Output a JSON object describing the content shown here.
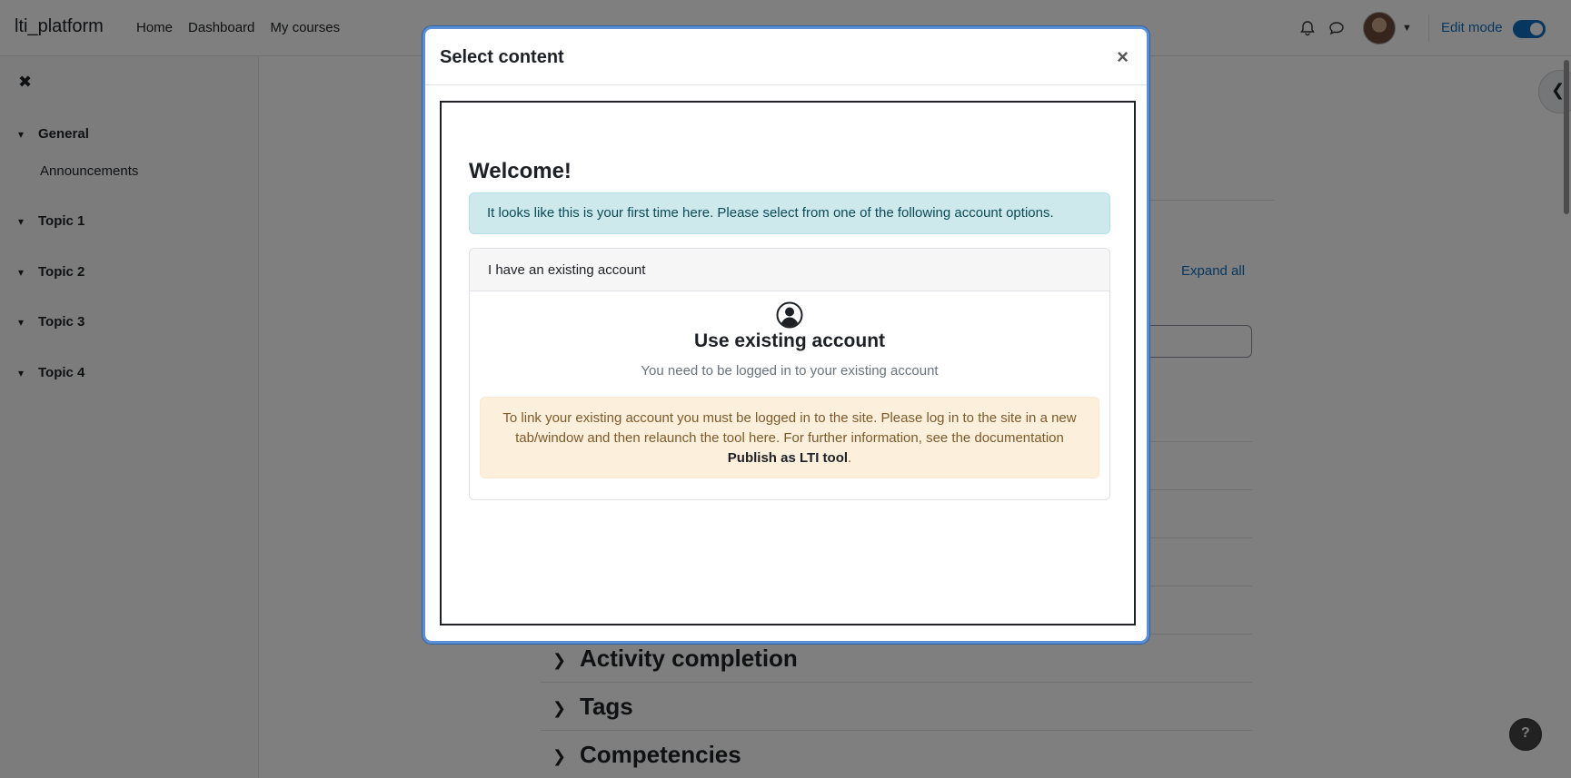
{
  "navbar": {
    "brand": "lti_platform",
    "links": [
      "Home",
      "Dashboard",
      "My courses"
    ],
    "edit_mode_label": "Edit mode"
  },
  "drawer": {
    "sections": [
      {
        "label": "General",
        "items": [
          "Announcements"
        ]
      },
      {
        "label": "Topic 1",
        "items": []
      },
      {
        "label": "Topic 2",
        "items": []
      },
      {
        "label": "Topic 3",
        "items": []
      },
      {
        "label": "Topic 4",
        "items": []
      }
    ]
  },
  "page": {
    "expand_all": "Expand all",
    "collapsed_sections": [
      "Activity completion",
      "Tags",
      "Competencies"
    ],
    "help_label": "?"
  },
  "modal": {
    "title": "Select content",
    "close_label": "×",
    "welcome": "Welcome!",
    "info_text": "It looks like this is your first time here. Please select from one of the following account options.",
    "card": {
      "header": "I have an existing account",
      "title": "Use existing account",
      "text": "You need to be logged in to your existing account",
      "warning_prefix": "To link your existing account you must be logged in to the site. Please log in to the site in a new tab/window and then relaunch the tool here. For further information, see the documentation ",
      "warning_link": "Publish as LTI tool",
      "warning_suffix": "."
    }
  },
  "colors": {
    "accent": "#0f6cbf",
    "info_bg": "#cde9ec",
    "warning_bg": "#fcefdc"
  }
}
